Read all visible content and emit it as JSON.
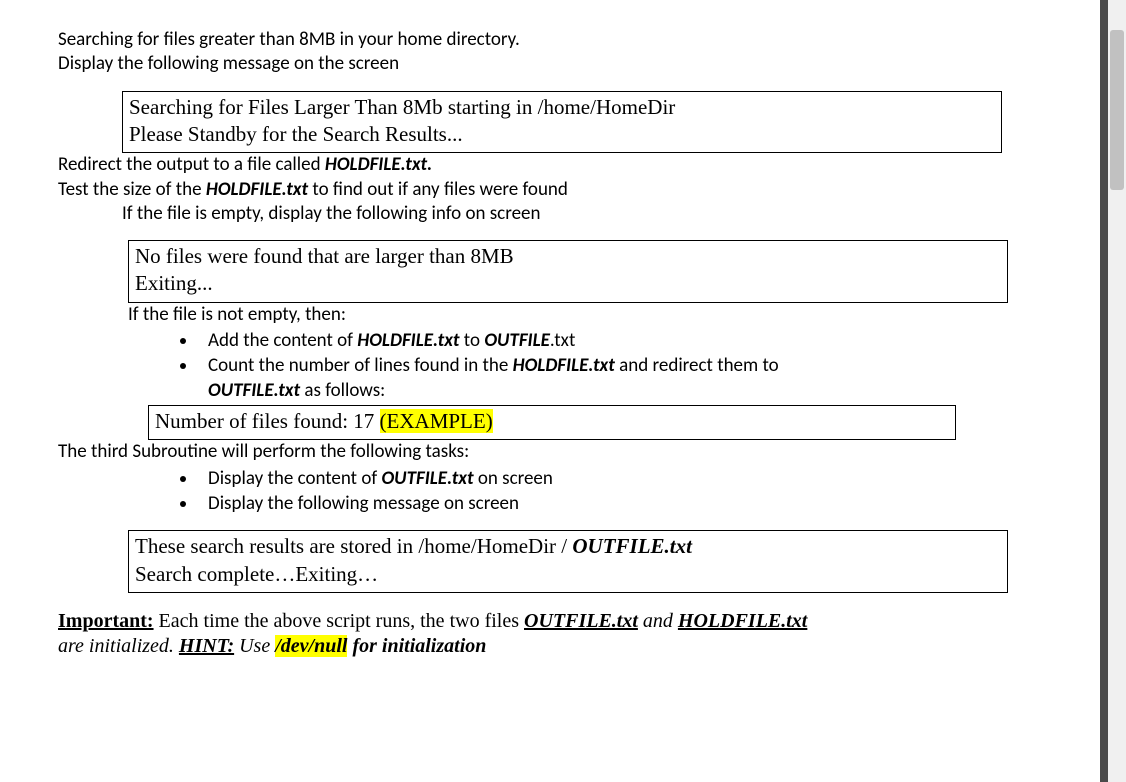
{
  "intro_line1": "Searching for files greater than 8MB in your home directory.",
  "intro_line2": "Display the following message on the screen",
  "box1_line1": "Searching for Files Larger Than 8Mb starting in /home/HomeDir",
  "box1_line2": "Please Standby for the Search Results...",
  "redirect_pre": "Redirect the output to a file called ",
  "redirect_file": "HOLDFILE.txt.",
  "test_pre": "Test the size of the ",
  "test_file": "HOLDFILE.txt",
  "test_post": " to find out if any files were found",
  "if_empty": "If the file is empty, display the following info on screen",
  "box2_line1": "No files were found that are larger than 8MB",
  "box2_line2": "Exiting...",
  "if_not_empty": "If the file is not empty, then:",
  "bullet1_pre": "Add the content of ",
  "bullet1_file1": "HOLDFILE.txt",
  "bullet1_mid": " to ",
  "bullet1_file2": "OUTFILE",
  "bullet1_post": ".txt",
  "bullet2_pre": "Count the number of lines found in the ",
  "bullet2_file": "HOLDFILE.txt",
  "bullet2_mid": " and redirect them to ",
  "bullet2_file2": "OUTFILE.txt",
  "bullet2_post": " as follows:",
  "box3_prefix": "Number of files found: 17  ",
  "box3_example": "(EXAMPLE)",
  "third_sub": "The third Subroutine will perform the following tasks:",
  "sub_bullet1_pre": "Display the content of ",
  "sub_bullet1_file": "OUTFILE.txt",
  "sub_bullet1_post": " on screen",
  "sub_bullet2": "Display the following message on screen",
  "box4_line1_pre": "These search results are stored in /home/HomeDir / ",
  "box4_line1_file": "OUTFILE.txt",
  "box4_line2": "Search complete…Exiting…",
  "important_label": "Important:",
  "important_text1": " Each time the above script runs, the two files ",
  "important_file1": "OUTFILE.txt",
  "important_and": " and ",
  "important_file2": "HOLDFILE.txt",
  "important_line2_pre": "are initialized. ",
  "important_hint": "HINT:",
  "important_use": " Use ",
  "important_devnull": "/dev/null",
  "important_tail": " for initialization"
}
